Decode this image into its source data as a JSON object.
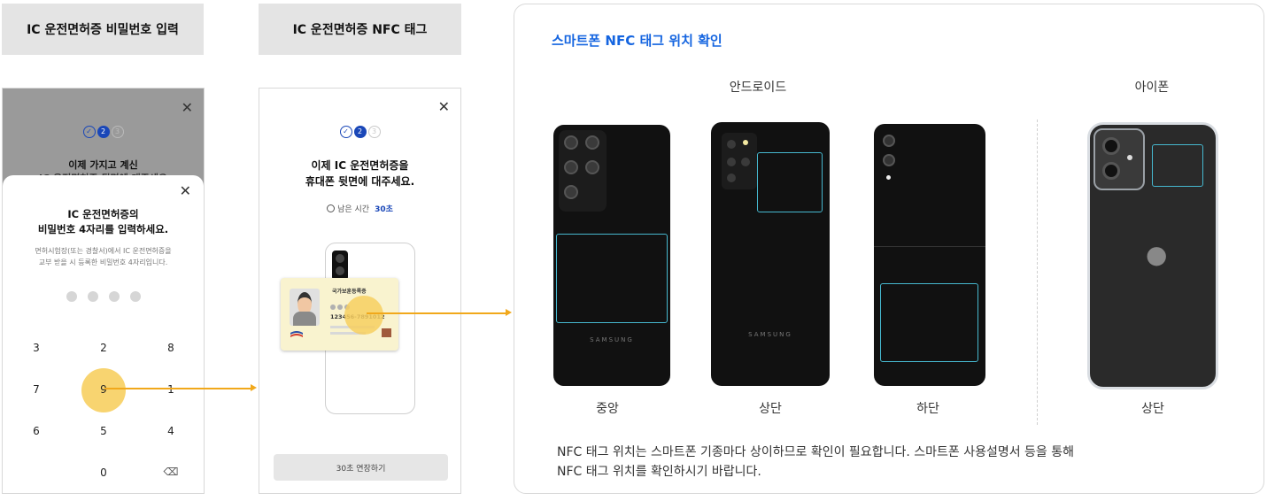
{
  "headers": {
    "pin_entry": "IC 운전면허증 비밀번호 입력",
    "nfc_tag": "IC 운전면허증 NFC 태그"
  },
  "pin_screen": {
    "steps": [
      "✓",
      "2",
      "3"
    ],
    "bg_title": "이제 가지고 계신",
    "bg_sub": "IC 운전면허증 뒷면에 대주세요",
    "title_line1": "IC 운전면허증의",
    "title_line2": "비밀번호 4자리를 입력하세요.",
    "desc_line1": "면허시험장(또는 경찰서)에서 IC 운전면허증을",
    "desc_line2": "교부 받을 시 등록한 비밀번호 4자리입니다.",
    "keys": [
      "3",
      "2",
      "8",
      "7",
      "9",
      "1",
      "6",
      "5",
      "4",
      "0"
    ],
    "highlighted_key": "9",
    "backspace_icon": "backspace-icon"
  },
  "nfc_screen": {
    "steps": [
      "✓",
      "2",
      "3"
    ],
    "title_line1": "이제 IC 운전면허증을",
    "title_line2": "휴대폰 뒷면에 대주세요.",
    "timer_label": "남은 시간",
    "timer_value": "30초",
    "card_title": "국가보훈등록증",
    "card_number": "123456-7891012",
    "extend_button": "30초 연장하기"
  },
  "panel": {
    "title": "스마트폰 NFC 태그 위치 확인",
    "android_label": "안드로이드",
    "iphone_label": "아이폰",
    "phones": [
      {
        "brand": "SAMSUNG",
        "position": "중앙"
      },
      {
        "brand": "SAMSUNG",
        "position": "상단"
      },
      {
        "brand": "",
        "position": "하단"
      },
      {
        "brand": "",
        "position": "상단"
      }
    ],
    "desc_line1": "NFC 태그 위치는 스마트폰 기종마다 상이하므로 확인이 필요합니다. 스마트폰 사용설명서 등을 통해",
    "desc_line2": "NFC 태그 위치를 확인하시기 바랍니다."
  },
  "colors": {
    "accent_blue": "#1565e0",
    "step_blue": "#1a47b8",
    "highlight_yellow": "#f7cf60",
    "arrow_orange": "#f1a81b",
    "nfc_cyan": "#46b8cf"
  }
}
